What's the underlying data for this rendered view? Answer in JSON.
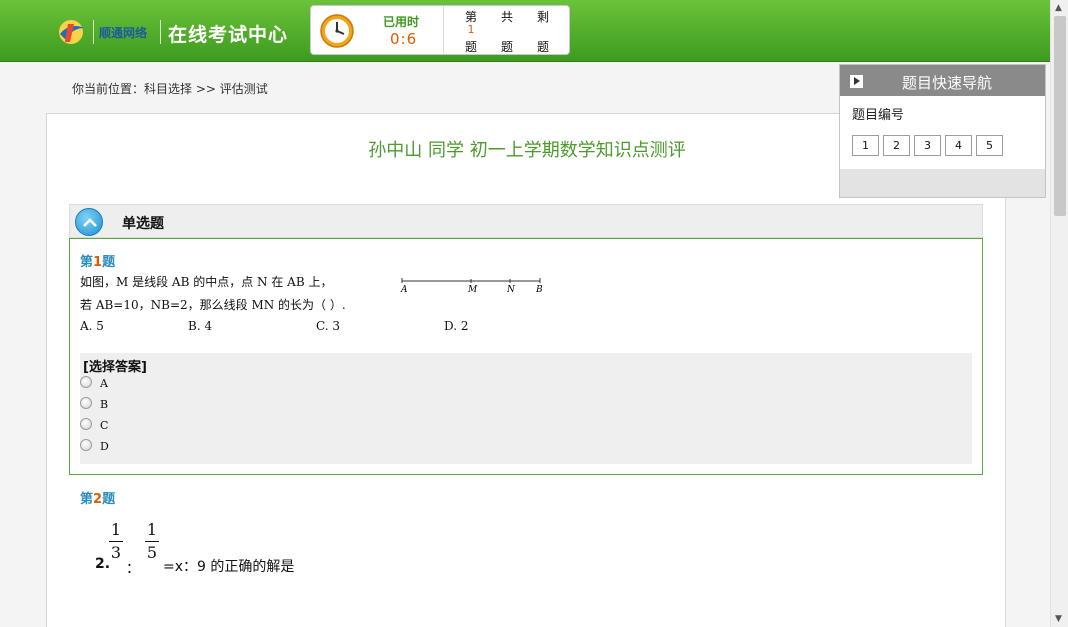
{
  "header": {
    "brand": "顺通网络",
    "title": "在线考试中心",
    "timer": {
      "used_label": "已用时",
      "used_value": "0:6"
    },
    "current": {
      "prefix": "第",
      "value": "1",
      "suffix": "题"
    },
    "total": {
      "prefix": "共",
      "value": "",
      "suffix": "题"
    },
    "remaining": {
      "prefix": "剩",
      "value": "",
      "suffix": "题"
    }
  },
  "breadcrumb": "你当前位置：科目选择 >> 评估测试",
  "exam_title": "孙中山 同学 初一上学期数学知识点测评",
  "section": {
    "label": "单选题"
  },
  "question1": {
    "title_prefix": "第",
    "number": "1",
    "title_suffix": "题",
    "line1": "如图，M 是线段 AB 的中点，点 N 在 AB 上，",
    "line2": "若 AB=10，NB=2，那么线段 MN 的长为（     ）.",
    "options": [
      "A. 5",
      "B. 4",
      "C. 3",
      "D. 2"
    ],
    "figure_labels": [
      "A",
      "M",
      "N",
      "B"
    ],
    "answer_label": "[选择答案]",
    "choices": [
      "A",
      "B",
      "C",
      "D"
    ]
  },
  "question2": {
    "title_prefix": "第",
    "number": "2",
    "title_suffix": "题",
    "num_label": "2.",
    "frac1": {
      "num": "1",
      "den": "3"
    },
    "colon": "：",
    "frac2": {
      "num": "1",
      "den": "5"
    },
    "tail": "=x：9 的正确的解是"
  },
  "nav": {
    "title": "题目快速导航",
    "subtitle": "题目编号",
    "numbers": [
      "1",
      "2",
      "3",
      "4",
      "5"
    ]
  },
  "colors": {
    "header_green": "#4fae2a",
    "accent_orange": "#e05a00",
    "title_green": "#4c9b2c",
    "link_blue": "#2a8dbd"
  }
}
